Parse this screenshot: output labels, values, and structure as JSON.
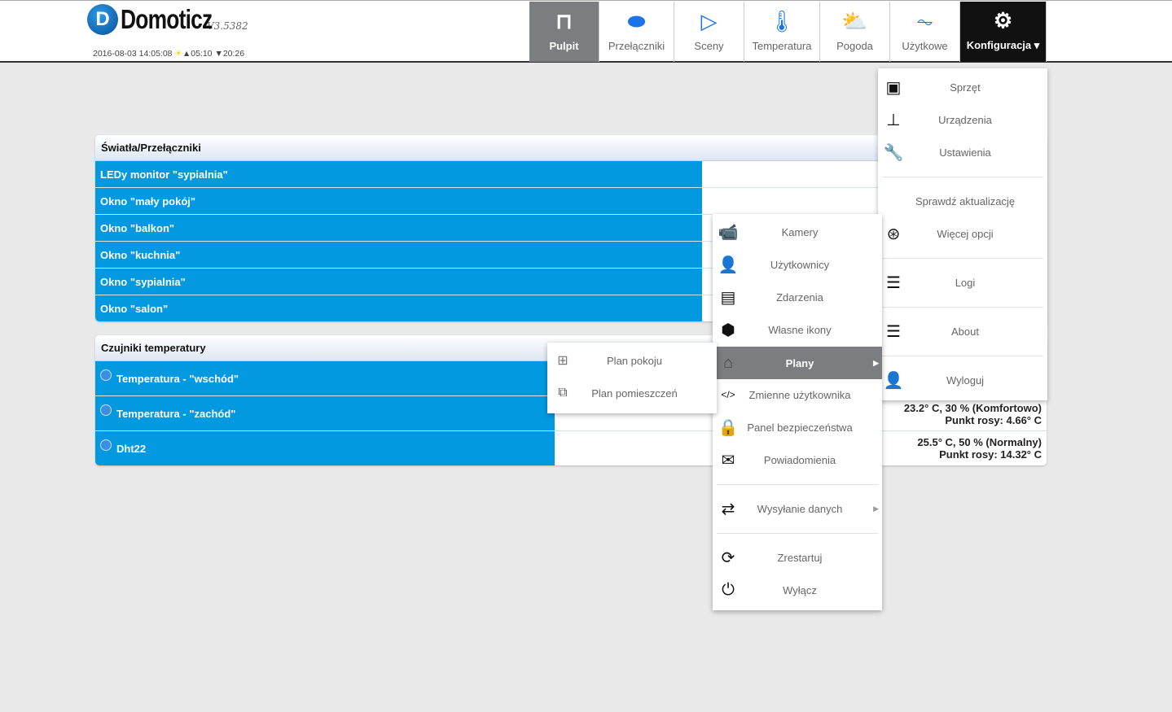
{
  "header": {
    "logo_letter": "D",
    "app_name": "Domoticz",
    "version": "V3.5382",
    "datetime": "2016-08-03 14:05:08",
    "sunrise": "▲05:10",
    "sunset": "▼20:26"
  },
  "nav": [
    {
      "label": "Pulpit",
      "icon": "bookmark-icon",
      "glyph": "⊓"
    },
    {
      "label": "Przełączniki",
      "icon": "toggle-icon",
      "glyph": "⬬"
    },
    {
      "label": "Sceny",
      "icon": "play-circle-icon",
      "glyph": "▷"
    },
    {
      "label": "Temperatura",
      "icon": "thermometer-icon",
      "glyph": "🌡"
    },
    {
      "label": "Pogoda",
      "icon": "weather-icon",
      "glyph": "⛅"
    },
    {
      "label": "Użytkowe",
      "icon": "pulse-icon",
      "glyph": "⏦"
    },
    {
      "label": "Konfiguracja",
      "icon": "gear-icon",
      "glyph": "⚙",
      "caret": "▾"
    }
  ],
  "switches": {
    "title": "Światła/Przełączniki",
    "rows": [
      "LEDy monitor \"sypialnia\"",
      "Okno \"mały pokój\"",
      "Okno \"balkon\"",
      "Okno \"kuchnia\"",
      "Okno \"sypialnia\"",
      "Okno \"salon\""
    ]
  },
  "temps": {
    "title": "Czujniki temperatury",
    "rows": [
      {
        "name": "Temperatura - \"wschód\"",
        "value": "23.2° C, 30 % (Komfortowo)",
        "dew": "Punkt rosy: 4.66° C"
      },
      {
        "name": "Temperatura - \"zachód\"",
        "value": "",
        "dew": ""
      },
      {
        "name": "Dht22",
        "value": "25.5° C, 50 % (Normalny)",
        "dew": "Punkt rosy: 14.32° C"
      }
    ]
  },
  "config_menu": [
    "Sprzęt",
    "Urządzenia",
    "Ustawienia",
    "Sprawdź aktualizację",
    "Więcej opcji",
    "Logi",
    "About",
    "Wyloguj"
  ],
  "more_menu": [
    "Kamery",
    "Użytkownicy",
    "Zdarzenia",
    "Własne ikony",
    "Plany",
    "Zmienne użytkownika",
    "Panel bezpieczeństwa",
    "Powiadomienia",
    "Wysyłanie danych",
    "Zrestartuj",
    "Wyłącz"
  ],
  "plans_menu": [
    "Plan pokoju",
    "Plan pomieszczeń"
  ],
  "colors": {
    "accent": "#0399e0",
    "active_nav": "#7b7d80",
    "konf_nav": "#111111"
  }
}
